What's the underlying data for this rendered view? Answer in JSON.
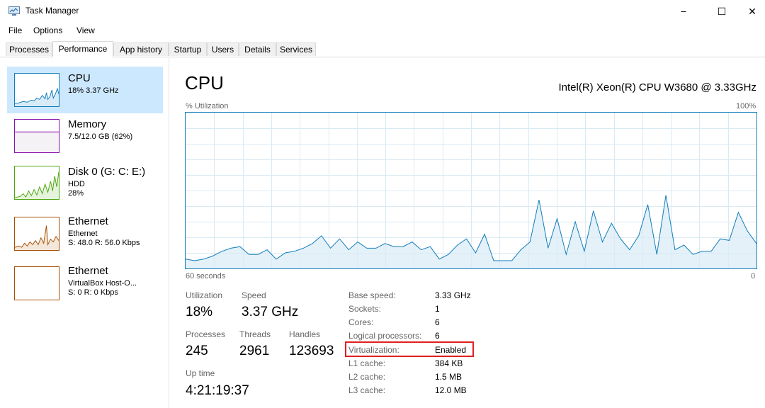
{
  "window": {
    "title": "Task Manager",
    "icon": "task-manager-icon",
    "controls": [
      "−",
      "☐",
      "✕"
    ]
  },
  "menu": {
    "file": "File",
    "options": "Options",
    "view": "View"
  },
  "tabs": [
    "Processes",
    "Performance",
    "App history",
    "Startup",
    "Users",
    "Details",
    "Services"
  ],
  "active_tab": "Performance",
  "sidebar": {
    "items": [
      {
        "title": "CPU",
        "lines": [
          "18% 3.37 GHz"
        ]
      },
      {
        "title": "Memory",
        "lines": [
          "7.5/12.0 GB (62%)"
        ]
      },
      {
        "title": "Disk 0 (G: C: E:)",
        "lines": [
          "HDD",
          "28%"
        ]
      },
      {
        "title": "Ethernet",
        "lines": [
          "Ethernet",
          "S: 48.0 R: 56.0 Kbps"
        ]
      },
      {
        "title": "Ethernet",
        "lines": [
          "VirtualBox Host-O...",
          "S: 0 R: 0 Kbps"
        ]
      }
    ]
  },
  "main": {
    "title": "CPU",
    "cpu_name": "Intel(R) Xeon(R) CPU W3680 @ 3.33GHz",
    "graph_top_left": "% Utilization",
    "graph_top_right": "100%",
    "graph_bottom_left": "60 seconds",
    "graph_bottom_right": "0"
  },
  "stats": {
    "utilization_label": "Utilization",
    "utilization": "18%",
    "speed_label": "Speed",
    "speed": "3.37 GHz",
    "processes_label": "Processes",
    "processes": "245",
    "threads_label": "Threads",
    "threads": "2961",
    "handles_label": "Handles",
    "handles": "123693",
    "uptime_label": "Up time",
    "uptime": "4:21:19:37"
  },
  "specs": [
    {
      "label": "Base speed:",
      "value": "3.33 GHz"
    },
    {
      "label": "Sockets:",
      "value": "1"
    },
    {
      "label": "Cores:",
      "value": "6"
    },
    {
      "label": "Logical processors:",
      "value": "6"
    },
    {
      "label": "Virtualization:",
      "value": "Enabled"
    },
    {
      "label": "L1 cache:",
      "value": "384 KB"
    },
    {
      "label": "L2 cache:",
      "value": "1.5 MB"
    },
    {
      "label": "L3 cache:",
      "value": "12.0 MB"
    }
  ],
  "colors": {
    "cpu": "#117dbb",
    "memory": "#8b12ae",
    "disk": "#4da60c",
    "ethernet": "#a74f01",
    "selected": "#cce8ff",
    "highlight": "#e02020"
  },
  "chart_data": {
    "type": "area",
    "ylim": [
      0,
      100
    ],
    "x_range_seconds": [
      60,
      0
    ],
    "values": [
      6,
      5,
      6,
      8,
      11,
      13,
      14,
      9,
      9,
      12,
      6,
      10,
      11,
      13,
      16,
      21,
      13,
      19,
      12,
      17,
      13,
      13,
      16,
      14,
      14,
      17,
      12,
      14,
      6,
      9,
      15,
      19,
      10,
      22,
      5,
      5,
      5,
      12,
      17,
      44,
      13,
      32,
      9,
      30,
      11,
      37,
      17,
      29,
      19,
      12,
      21,
      41,
      9,
      47,
      12,
      15,
      9,
      11,
      11,
      19,
      18,
      36,
      24,
      16
    ]
  }
}
